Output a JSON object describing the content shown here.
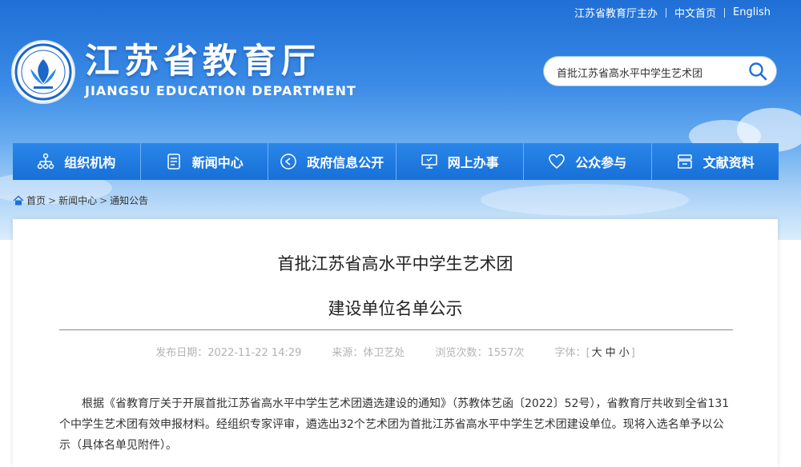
{
  "top_links": {
    "sponsor": "江苏省教育厅主办",
    "home_cn": "中文首页",
    "english": "English"
  },
  "logo": {
    "title": "江苏省教育厅",
    "subtitle": "JIANGSU EDUCATION DEPARTMENT"
  },
  "search": {
    "value": "首批江苏省高水平中学生艺术团"
  },
  "nav": {
    "items": [
      {
        "label": "组织机构",
        "icon": "org-chart-icon"
      },
      {
        "label": "新闻中心",
        "icon": "document-list-icon"
      },
      {
        "label": "政府信息公开",
        "icon": "play-circle-icon"
      },
      {
        "label": "网上办事",
        "icon": "monitor-icon"
      },
      {
        "label": "公众参与",
        "icon": "heart-icon"
      },
      {
        "label": "文献资料",
        "icon": "archive-icon"
      }
    ]
  },
  "breadcrumb": {
    "items": [
      "首页",
      "新闻中心",
      "通知公告"
    ]
  },
  "article": {
    "title_line1": "首批江苏省高水平中学生艺术团",
    "title_line2": "建设单位名单公示",
    "publish_label": "发布日期：",
    "publish_date": "2022-11-22 14:29",
    "source_label": "来源：",
    "source": "体卫艺处",
    "views_label": "浏览次数：",
    "views": "1557次",
    "font_label": "字体：",
    "font_large": "大",
    "font_medium": "中",
    "font_small": "小",
    "paragraph": "根据《省教育厅关于开展首批江苏省高水平中学生艺术团遴选建设的通知》（苏教体艺函〔2022〕52号），省教育厅共收到全省131个中学生艺术团有效申报材料。经组织专家评审，遴选出32个艺术团为首批江苏省高水平中学生艺术团建设单位。现将入选名单予以公示（具体名单见附件）。"
  },
  "colors": {
    "nav_blue": "#1f7be2",
    "sky_top": "#1f6fd6",
    "meta_gray": "#b3b3b3"
  }
}
